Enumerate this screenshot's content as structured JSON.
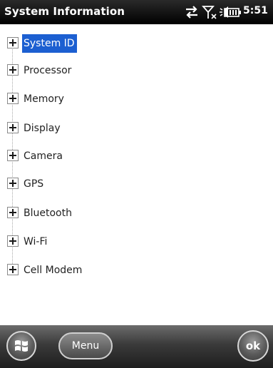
{
  "titlebar": {
    "title": "System Information",
    "time": "5:51",
    "icons": [
      "connectivity-arrows-icon",
      "signal-off-icon",
      "speaker-icon",
      "battery-icon"
    ]
  },
  "tree": {
    "items": [
      {
        "label": "System ID",
        "selected": true
      },
      {
        "label": "Processor",
        "selected": false
      },
      {
        "label": "Memory",
        "selected": false
      },
      {
        "label": "Display",
        "selected": false
      },
      {
        "label": "Camera",
        "selected": false
      },
      {
        "label": "GPS",
        "selected": false
      },
      {
        "label": "Bluetooth",
        "selected": false
      },
      {
        "label": "Wi-Fi",
        "selected": false
      },
      {
        "label": "Cell Modem",
        "selected": false
      }
    ]
  },
  "softbar": {
    "menu_label": "Menu",
    "ok_label": "ok"
  },
  "colors": {
    "selection": "#1c5fd1",
    "titlebar": "#000000"
  }
}
